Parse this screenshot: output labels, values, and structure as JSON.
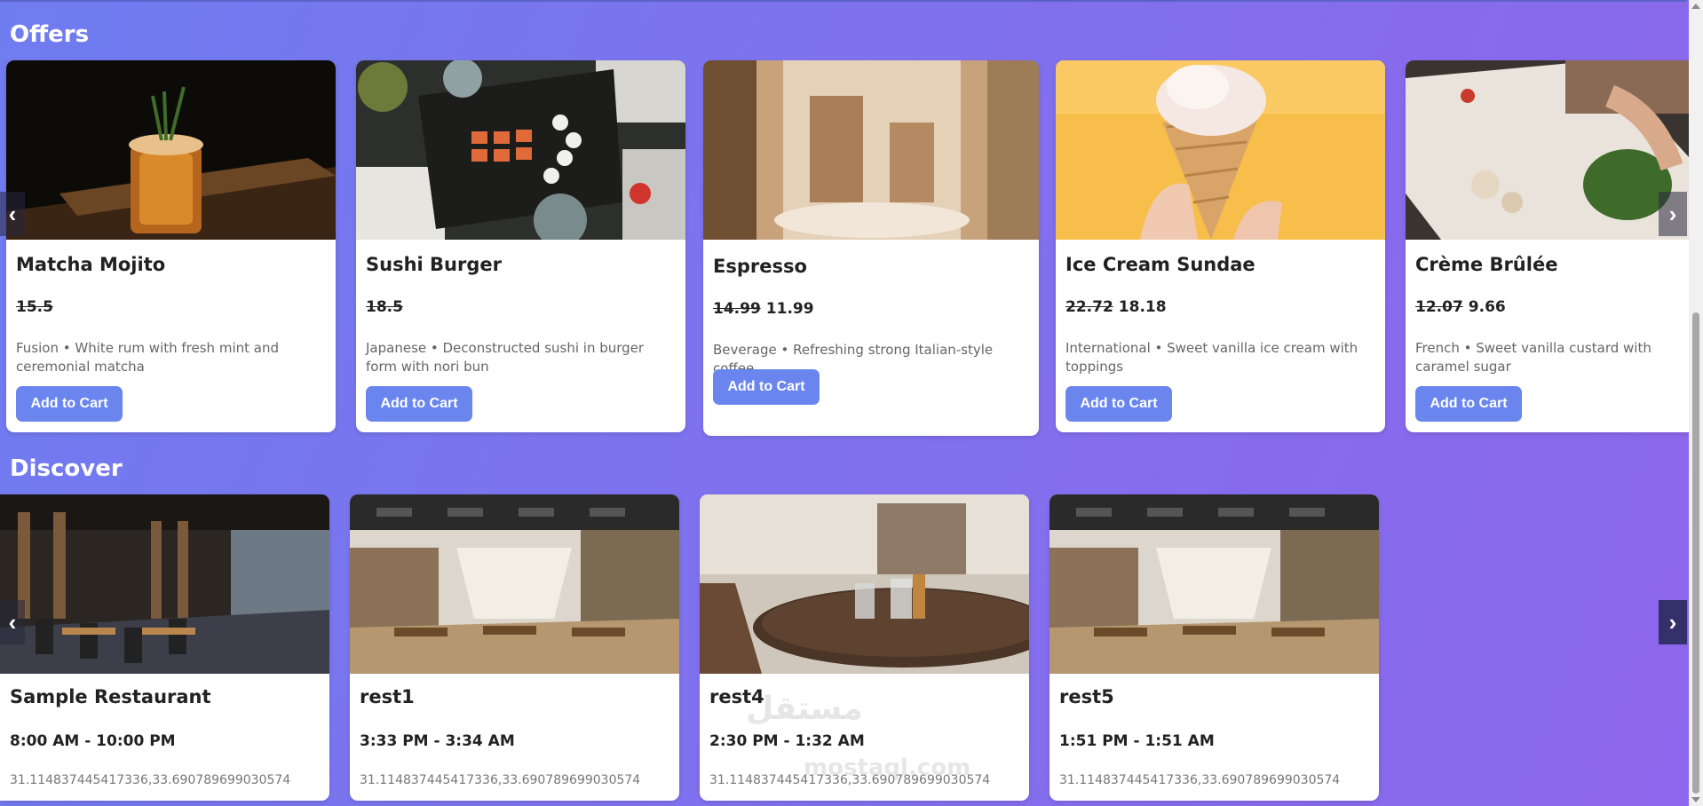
{
  "offers": {
    "title": "Offers",
    "items": [
      {
        "name": "Matcha Mojito",
        "old_price": "15.5",
        "new_price": "",
        "desc": "Fusion • White rum with fresh mint and ceremonial matcha",
        "button": "Add to Cart"
      },
      {
        "name": "Sushi Burger",
        "old_price": "18.5",
        "new_price": "",
        "desc": "Japanese • Deconstructed sushi in burger form with nori bun",
        "button": "Add to Cart"
      },
      {
        "name": "Espresso",
        "old_price": "14.99",
        "new_price": "11.99",
        "desc": "Beverage • Refreshing strong Italian-style coffee",
        "button": "Add to Cart"
      },
      {
        "name": "Ice Cream Sundae",
        "old_price": "22.72",
        "new_price": "18.18",
        "desc": "International • Sweet vanilla ice cream with toppings",
        "button": "Add to Cart"
      },
      {
        "name": "Crème Brûlée",
        "old_price": "12.07",
        "new_price": "9.66",
        "desc": "French • Sweet vanilla custard with caramel sugar",
        "button": "Add to Cart"
      }
    ],
    "prev_arrow": "‹",
    "next_arrow": "›"
  },
  "discover": {
    "title": "Discover",
    "items": [
      {
        "name": "Sample Restaurant",
        "hours": "8:00 AM - 10:00 PM",
        "coords": "31.114837445417336,33.690789699030574"
      },
      {
        "name": "rest1",
        "hours": "3:33 PM - 3:34 AM",
        "coords": "31.114837445417336,33.690789699030574"
      },
      {
        "name": "rest4",
        "hours": "2:30 PM - 1:32 AM",
        "coords": "31.114837445417336,33.690789699030574"
      },
      {
        "name": "rest5",
        "hours": "1:51 PM - 1:51 AM",
        "coords": "31.114837445417336,33.690789699030574"
      }
    ],
    "prev_arrow": "‹",
    "next_arrow": "›"
  },
  "watermark": {
    "arabic": "مستقل",
    "latin": "mostaql.com"
  }
}
